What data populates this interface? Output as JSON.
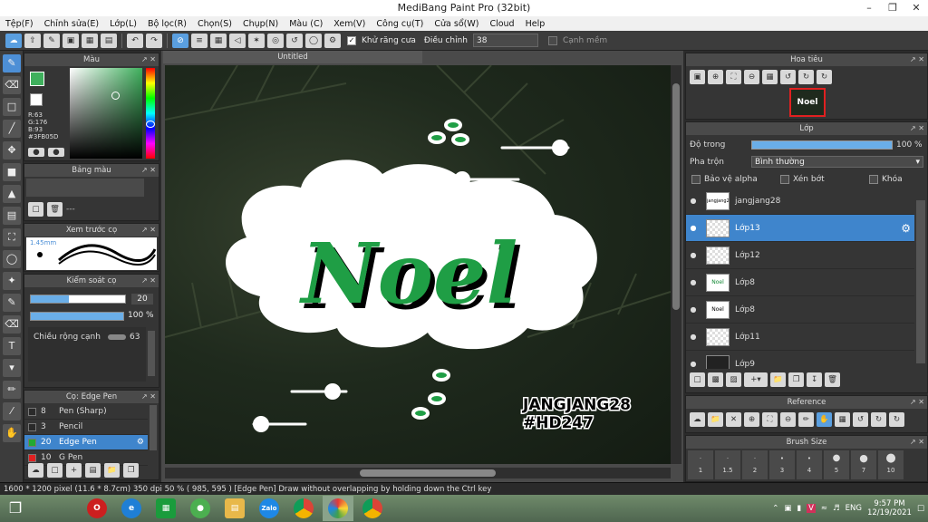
{
  "window": {
    "title": "MediBang Paint Pro (32bit)"
  },
  "menu": [
    "Tệp(F)",
    "Chỉnh sửa(E)",
    "Lớp(L)",
    "Bộ lọc(R)",
    "Chọn(S)",
    "Chụp(N)",
    "Màu (C)",
    "Xem(V)",
    "Công cụ(T)",
    "Cửa sổ(W)",
    "Cloud",
    "Help"
  ],
  "toolbar": {
    "antialias_label": "Khử răng cưa",
    "adjust_label": "Điều chỉnh",
    "adjust_value": "38",
    "smooth_edge_label": "Cạnh mềm"
  },
  "color_panel": {
    "title": "Màu",
    "r": "R:63",
    "g": "G:176",
    "b": "B:93",
    "hex": "#3FB05D"
  },
  "palette_panel": {
    "title": "Bảng màu",
    "empty": "---"
  },
  "brush_preview": {
    "title": "Xem trước cọ",
    "size": "1.45mm"
  },
  "brush_control": {
    "title": "Kiểm soát cọ",
    "size_value": "20",
    "opacity_value": "100 %",
    "edge_label": "Chiều rộng cạnh",
    "edge_value": "63"
  },
  "brush_list": {
    "title": "Cọ: Edge Pen",
    "items": [
      {
        "num": "8",
        "name": "Pen (Sharp)",
        "color": "#2a2a2a",
        "selected": false
      },
      {
        "num": "3",
        "name": "Pencil",
        "color": "#2a2a2a",
        "selected": false
      },
      {
        "num": "20",
        "name": "Edge Pen",
        "color": "#22aa33",
        "selected": true
      },
      {
        "num": "10",
        "name": "G Pen",
        "color": "#e02020",
        "selected": false
      }
    ]
  },
  "canvas": {
    "tab": "Untitled",
    "title_text": "Noel",
    "signature_line1": "JANGJANG28",
    "signature_line2": "#HD247"
  },
  "navigator": {
    "title": "Hoa tiêu"
  },
  "layer_panel": {
    "title": "Lớp",
    "opacity_label": "Độ trong",
    "opacity_value": "100 %",
    "blend_label": "Pha trộn",
    "blend_value": "Bình thường",
    "protect_alpha": "Bảo vệ alpha",
    "clipping": "Xén bớt",
    "lock": "Khóa",
    "layers": [
      {
        "name": "jangjang28",
        "thumb": "jangjang28",
        "style": "plain"
      },
      {
        "name": "Lớp13",
        "thumb": "",
        "style": "check"
      },
      {
        "name": "Lớp12",
        "thumb": "",
        "style": "check"
      },
      {
        "name": "Lớp8",
        "thumb": "Noel",
        "style": "plain"
      },
      {
        "name": "Lớp8",
        "thumb": "Noel",
        "style": "plain"
      },
      {
        "name": "Lớp11",
        "thumb": "",
        "style": "check"
      },
      {
        "name": "Lớp9",
        "thumb": "",
        "style": "dark"
      }
    ]
  },
  "reference_panel": {
    "title": "Reference"
  },
  "brush_size_panel": {
    "title": "Brush Size",
    "sizes": [
      "1",
      "1.5",
      "2",
      "3",
      "4",
      "5",
      "7",
      "10"
    ]
  },
  "status": {
    "text": "1600 * 1200 pixel   (11.6 * 8.7cm)   350 dpi   50 %   ( 985, 595 )   [Edge Pen] Draw without overlapping by holding down the Ctrl key"
  },
  "taskbar": {
    "lang": "ENG",
    "time": "9:57 PM",
    "date": "12/19/2021",
    "zalo": "Zalo"
  }
}
